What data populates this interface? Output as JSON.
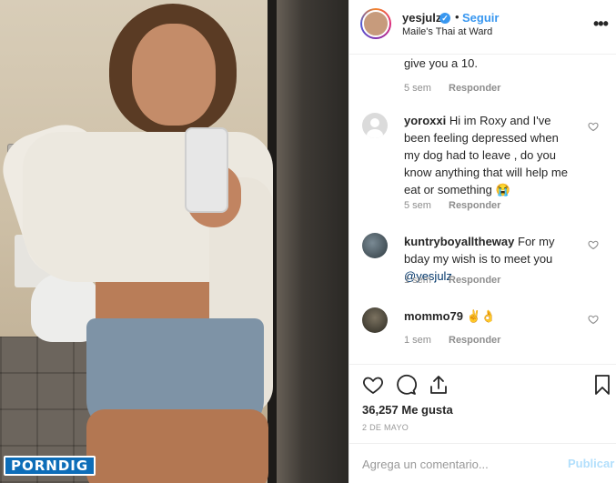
{
  "post_header": {
    "username": "yesjulz",
    "verified_glyph": "✓",
    "separator": "•",
    "follow_label": "Seguir",
    "location": "Maile's Thai at Ward",
    "more_icon": "more-horizontal-icon"
  },
  "comments": [
    {
      "username": "",
      "text": "give you a 10.",
      "age": "5 sem",
      "reply_label": "Responder",
      "partial": true
    },
    {
      "username": "yoroxxi",
      "text": "Hi im Roxy and I've been feeling depressed when my dog had to leave , do you know anything that will help me eat or something 😭",
      "age": "5 sem",
      "reply_label": "Responder",
      "avatar": "default-avatar"
    },
    {
      "username": "kuntryboyalltheway",
      "text": "For my bday my wish is to meet you",
      "mention": "@yesjulz",
      "age": "1 sem",
      "reply_label": "Responder",
      "avatar": "photo-avatar"
    },
    {
      "username": "mommo79",
      "text": "✌️👌",
      "age": "1 sem",
      "reply_label": "Responder",
      "avatar": "photo-avatar"
    }
  ],
  "actions": {
    "like_icon": "heart-icon",
    "comment_icon": "comment-icon",
    "share_icon": "share-icon",
    "save_icon": "bookmark-icon"
  },
  "likes_text": "36,257 Me gusta",
  "post_date": "2 DE MAYO",
  "comment_box": {
    "placeholder": "Agrega un comentario...",
    "publish_label": "Publicar"
  },
  "watermark": "PORNDIG",
  "colors": {
    "accent": "#3897f0",
    "publish_disabled": "#b2dffc",
    "muted": "#8e8e8e",
    "watermark_bg": "#0d6db8"
  }
}
